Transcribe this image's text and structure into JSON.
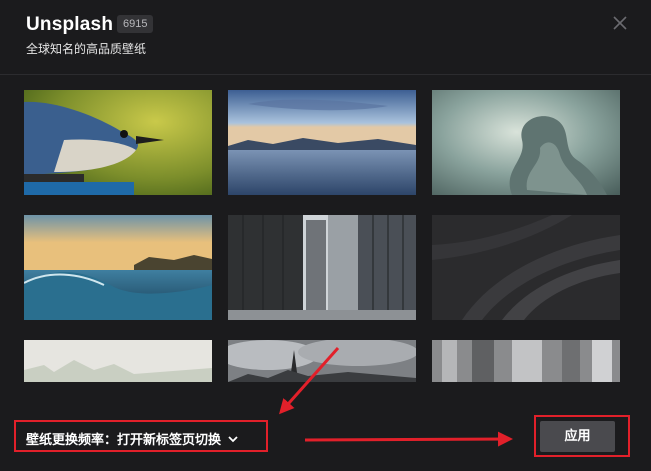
{
  "header": {
    "title": "Unsplash",
    "count": "6915",
    "subtitle": "全球知名的高品质壁纸"
  },
  "icons": {
    "close": "close-icon",
    "dropdown": "chevron-down-icon"
  },
  "wallpapers": [
    {
      "subject": "bird"
    },
    {
      "subject": "lake"
    },
    {
      "subject": "clouds"
    },
    {
      "subject": "wave"
    },
    {
      "subject": "city"
    },
    {
      "subject": "dark-abstract"
    },
    {
      "subject": "foggy-forest"
    },
    {
      "subject": "church-clouds"
    },
    {
      "subject": "blur"
    }
  ],
  "footer": {
    "frequency_label": "壁纸更换频率：打开新标签页切换",
    "apply_label": "应用"
  },
  "colors": {
    "background": "#1b1b1d",
    "annotation": "#e2202a",
    "button": "#4a4a4e"
  }
}
